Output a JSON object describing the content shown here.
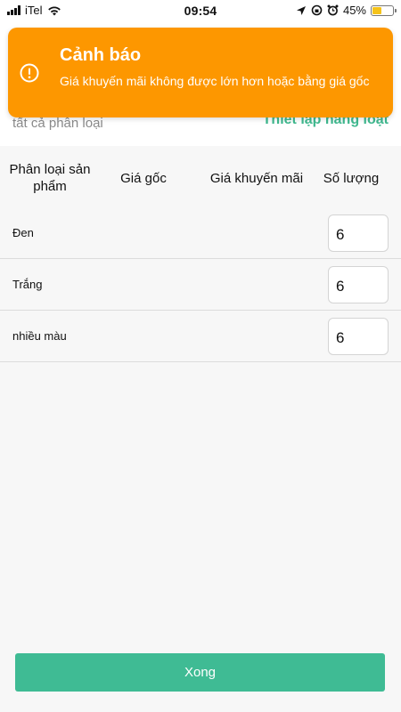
{
  "status_bar": {
    "carrier": "iTel",
    "time": "09:54",
    "battery_percent": "45%",
    "battery_level": 0.45
  },
  "background": {
    "left_text": "tất cả phân loại",
    "right_text": "Thiết lập hàng loạt"
  },
  "toast": {
    "title": "Cảnh báo",
    "message": "Giá khuyến mãi không được lớn hơn hoặc bằng giá gốc",
    "icon": "alert-circle-icon",
    "color": "#fd9700"
  },
  "table": {
    "headers": {
      "variant": "Phân loại sản phẩm",
      "original_price": "Giá gốc",
      "promo_price": "Giá khuyến mãi",
      "quantity": "Số lượng"
    },
    "rows": [
      {
        "label": "Đen",
        "quantity": "6"
      },
      {
        "label": "Trắng",
        "quantity": "6"
      },
      {
        "label": "nhiều màu",
        "quantity": "6"
      }
    ]
  },
  "footer": {
    "done_label": "Xong",
    "accent": "#3fbb94"
  }
}
